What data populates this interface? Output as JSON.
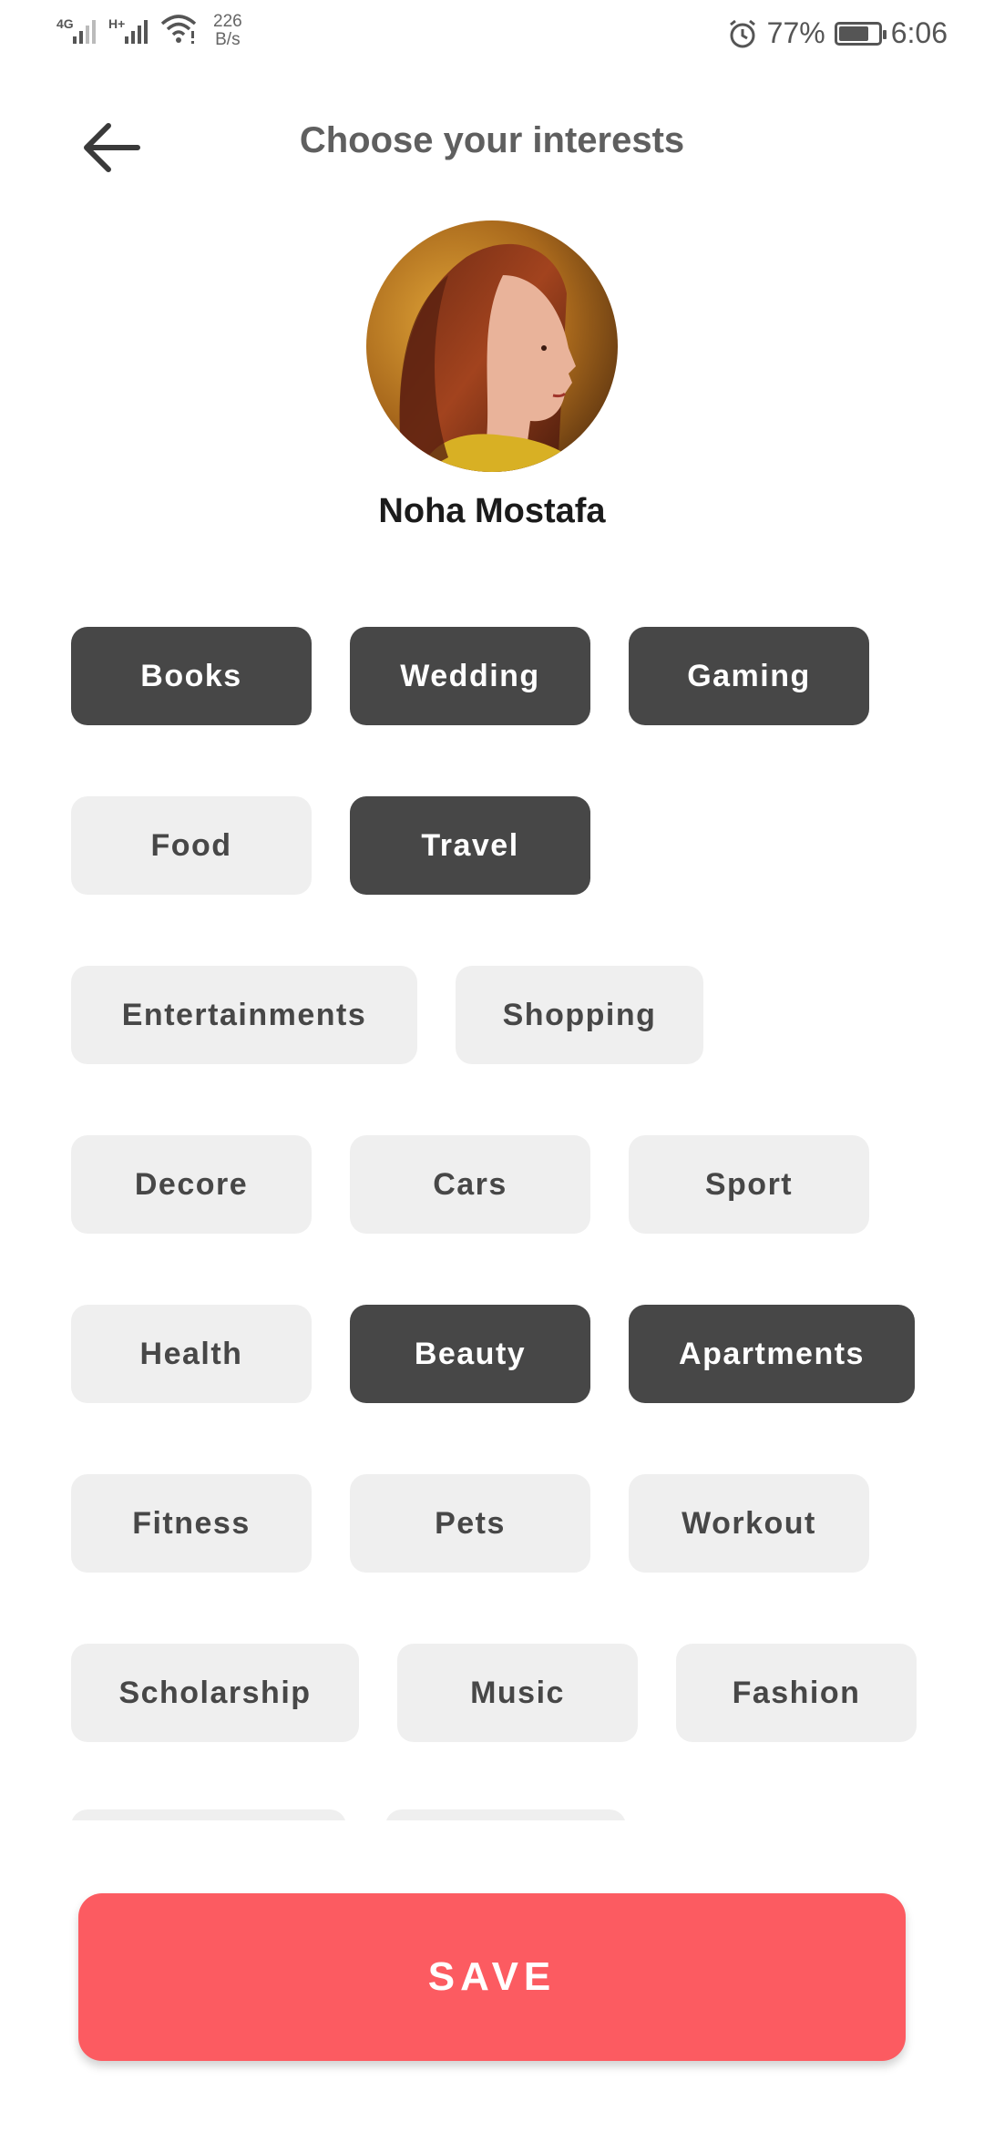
{
  "status_bar": {
    "network1": "4G",
    "network2": "H+",
    "speed_value": "226",
    "speed_unit": "B/s",
    "battery_text": "77%",
    "battery_level": 0.77,
    "time": "6:06"
  },
  "header": {
    "title": "Choose your interests"
  },
  "profile": {
    "name": "Noha Mostafa"
  },
  "interests": [
    {
      "label": "Books",
      "selected": true
    },
    {
      "label": "Wedding",
      "selected": true
    },
    {
      "label": "Gaming",
      "selected": true
    },
    {
      "label": "Food",
      "selected": false
    },
    {
      "label": "Travel",
      "selected": true
    },
    {
      "label": "Entertainments",
      "selected": false
    },
    {
      "label": "Shopping",
      "selected": false
    },
    {
      "label": "Decore",
      "selected": false
    },
    {
      "label": "Cars",
      "selected": false
    },
    {
      "label": "Sport",
      "selected": false
    },
    {
      "label": "Health",
      "selected": false
    },
    {
      "label": "Beauty",
      "selected": true
    },
    {
      "label": "Apartments",
      "selected": true
    },
    {
      "label": "Fitness",
      "selected": false
    },
    {
      "label": "Pets",
      "selected": false
    },
    {
      "label": "Workout",
      "selected": false
    },
    {
      "label": "Scholarship",
      "selected": false
    },
    {
      "label": "Music",
      "selected": false
    },
    {
      "label": "Fashion",
      "selected": false
    }
  ],
  "actions": {
    "save_label": "SAVE"
  },
  "colors": {
    "accent": "#fc5b61",
    "chip_selected": "#474747",
    "chip_unselected": "#efefef"
  }
}
